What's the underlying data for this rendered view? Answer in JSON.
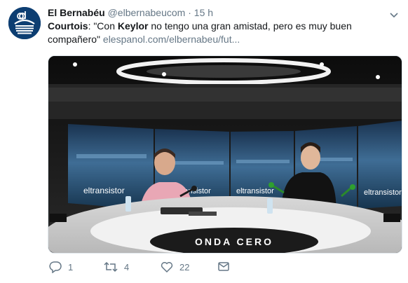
{
  "tweet": {
    "author_name": "El Bernabéu",
    "handle": "@elbernabeucom",
    "separator": "·",
    "time": "15 h",
    "avatar_text": "eb",
    "text_subject": "Courtois",
    "text_part1": ": \"Con ",
    "text_bold": "Keylor",
    "text_part2": " no tengo una gran amistad, pero es muy buen compañero\" ",
    "link": "elespanol.com/elbernabeu/fut..."
  },
  "media": {
    "screen_brand": "eltransistor",
    "desk_brand": "ONDA CERO"
  },
  "actions": {
    "reply_count": "1",
    "retweet_count": "4",
    "like_count": "22"
  },
  "colors": {
    "avatar_bg": "#0d3e72",
    "text": "#14171a",
    "secondary": "#657786"
  }
}
